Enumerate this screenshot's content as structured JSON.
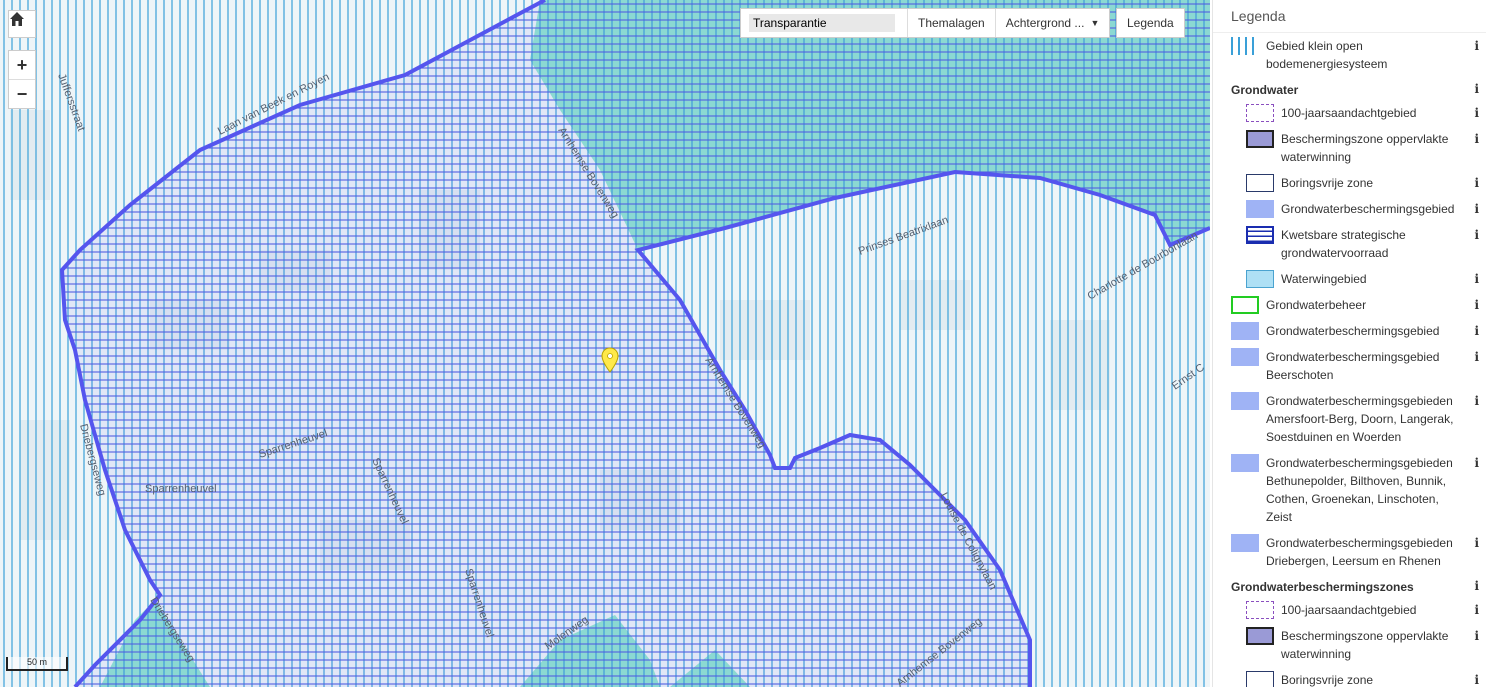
{
  "map": {
    "street_labels": [
      "Juffersstraat",
      "Laan van Beek en Royen",
      "Arnhemse Bovenweg",
      "Prinses Beatrixlaan",
      "Charlotte de Bourbonlaan",
      "Ernst C",
      "Driebergseweg",
      "Sparrenheuvel",
      "Sparrenheuvel",
      "Sparrenheuvel",
      "Sparrenheuvel",
      "Molenweg",
      "Arnhemse Bovenweg",
      "Louise de Colignylaan",
      "Driebergseweg",
      "Arnhemse Bovenweg"
    ],
    "scale_label": "50 m",
    "colors": {
      "hatch": "#3aa0d8",
      "boundary": "#5555ee",
      "teal": "#8fe6d0",
      "base": "#eef5f8"
    },
    "marker_icon": "map-pin-icon"
  },
  "controls": {
    "home_icon": "home-icon",
    "zoom_in": "+",
    "zoom_out": "−"
  },
  "toolbar": {
    "transparency_value": "Transparantie",
    "themalagen": "Themalagen",
    "achtergrond": "Achtergrond ...",
    "legenda": "Legenda"
  },
  "legend": {
    "title": "Legenda",
    "info_glyph": "i",
    "items": [
      {
        "type": "item",
        "indent": 1,
        "label": "Gebied klein open bodemenergiesysteem",
        "swatch": "vlines"
      },
      {
        "type": "group",
        "label": "Grondwater"
      },
      {
        "type": "item",
        "indent": 2,
        "label": "100-jaarsaandachtgebied",
        "swatch": "dashed"
      },
      {
        "type": "item",
        "indent": 2,
        "label": "Beschermingszone oppervlakte waterwinning",
        "swatch": "darkbox"
      },
      {
        "type": "item",
        "indent": 2,
        "label": "Boringsvrije zone",
        "swatch": "outline"
      },
      {
        "type": "item",
        "indent": 2,
        "label": "Grondwaterbeschermingsgebied",
        "swatch": "fill"
      },
      {
        "type": "item",
        "indent": 2,
        "label": "Kwetsbare strategische grondwatervoorraad",
        "swatch": "hlines"
      },
      {
        "type": "item",
        "indent": 2,
        "label": "Waterwingebied",
        "swatch": "lightblue"
      },
      {
        "type": "item",
        "indent": 1,
        "label": "Grondwaterbeheer",
        "swatch": "green"
      },
      {
        "type": "item",
        "indent": 1,
        "label": "Grondwaterbeschermingsgebied",
        "swatch": "fill"
      },
      {
        "type": "item",
        "indent": 1,
        "label": "Grondwaterbeschermingsgebied Beerschoten",
        "swatch": "fill"
      },
      {
        "type": "item",
        "indent": 1,
        "label": "Grondwaterbeschermingsgebieden Amersfoort-Berg, Doorn, Langerak, Soestduinen en Woerden",
        "swatch": "fill"
      },
      {
        "type": "item",
        "indent": 1,
        "label": "Grondwaterbeschermingsgebieden Bethunepolder, Bilthoven, Bunnik, Cothen, Groenekan, Linschoten, Zeist",
        "swatch": "fill"
      },
      {
        "type": "item",
        "indent": 1,
        "label": "Grondwaterbeschermingsgebieden Driebergen, Leersum en Rhenen",
        "swatch": "fill"
      },
      {
        "type": "group",
        "label": "Grondwaterbeschermingszones"
      },
      {
        "type": "item",
        "indent": 2,
        "label": "100-jaarsaandachtgebied",
        "swatch": "dashed"
      },
      {
        "type": "item",
        "indent": 2,
        "label": "Beschermingszone oppervlakte waterwinning",
        "swatch": "darkbox"
      },
      {
        "type": "item",
        "indent": 2,
        "label": "Boringsvrije zone",
        "swatch": "outline"
      }
    ]
  }
}
